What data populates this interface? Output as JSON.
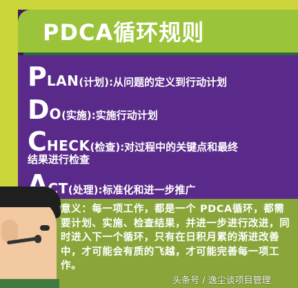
{
  "title": "PDCA循环规则",
  "rows": [
    {
      "letter": "P",
      "rest": "LAN",
      "cn": "(计划)",
      "desc": ":从问题的定义到行动计划"
    },
    {
      "letter": "D",
      "rest": "O",
      "cn": "(实施)",
      "desc": ":实施行动计划"
    },
    {
      "letter": "C",
      "rest": "HECK",
      "cn": "(检查)",
      "desc": ":对过程中的关键点和最终",
      "desc2": "结果进行检查"
    },
    {
      "letter": "A",
      "rest": "CT",
      "cn": "(处理)",
      "desc": ":标准化和进一步推广"
    }
  ],
  "meaning": "意义：每一项工作，都是一个 PDCA循环，都需要计划、实施、检查结果，并进一步进行改进，同时进入下一个循环，只有在日积月累的渐进改善中，才可能会有质的飞越，才可能完善每一项工作。",
  "watermark": "头条号 / 逸尘谈项目管理",
  "colors": {
    "frame": "#cbd63a",
    "banner": "#9cc43b",
    "panel": "#5a2a8a",
    "meaning_box": "#8aa63a",
    "text": "#ffffff"
  }
}
